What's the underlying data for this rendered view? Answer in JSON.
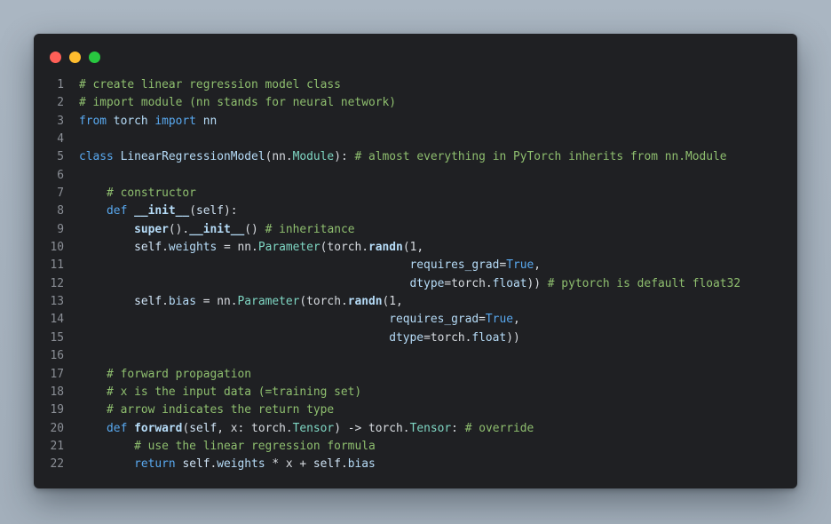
{
  "window": {
    "buttons": [
      "close",
      "minimize",
      "maximize"
    ]
  },
  "code": {
    "lines": [
      {
        "n": "1",
        "tokens": [
          {
            "t": "# create linear regression model class",
            "c": "comment"
          }
        ]
      },
      {
        "n": "2",
        "tokens": [
          {
            "t": "# import module (nn stands for neural network)",
            "c": "comment"
          }
        ]
      },
      {
        "n": "3",
        "tokens": [
          {
            "t": "from",
            "c": "kw"
          },
          {
            "t": " torch ",
            "c": "attr"
          },
          {
            "t": "import",
            "c": "kw"
          },
          {
            "t": " nn",
            "c": "attr"
          }
        ]
      },
      {
        "n": "4",
        "tokens": []
      },
      {
        "n": "5",
        "tokens": [
          {
            "t": "class",
            "c": "kw"
          },
          {
            "t": " LinearRegressionModel",
            "c": "cls"
          },
          {
            "t": "(nn.",
            "c": "plain"
          },
          {
            "t": "Module",
            "c": "type"
          },
          {
            "t": "): ",
            "c": "plain"
          },
          {
            "t": "# almost everything in PyTorch inherits from nn.Module",
            "c": "comment"
          }
        ]
      },
      {
        "n": "6",
        "tokens": []
      },
      {
        "n": "7",
        "tokens": [
          {
            "t": "    ",
            "c": "plain"
          },
          {
            "t": "# constructor",
            "c": "comment"
          }
        ]
      },
      {
        "n": "8",
        "tokens": [
          {
            "t": "    ",
            "c": "plain"
          },
          {
            "t": "def",
            "c": "kw"
          },
          {
            "t": " __init__",
            "c": "fn"
          },
          {
            "t": "(",
            "c": "plain"
          },
          {
            "t": "self",
            "c": "self"
          },
          {
            "t": "):",
            "c": "plain"
          }
        ]
      },
      {
        "n": "9",
        "tokens": [
          {
            "t": "        ",
            "c": "plain"
          },
          {
            "t": "super",
            "c": "fn"
          },
          {
            "t": "().",
            "c": "plain"
          },
          {
            "t": "__init__",
            "c": "fn"
          },
          {
            "t": "() ",
            "c": "plain"
          },
          {
            "t": "# inheritance",
            "c": "comment"
          }
        ]
      },
      {
        "n": "10",
        "tokens": [
          {
            "t": "        ",
            "c": "plain"
          },
          {
            "t": "self",
            "c": "self"
          },
          {
            "t": ".",
            "c": "plain"
          },
          {
            "t": "weights",
            "c": "attr"
          },
          {
            "t": " = nn.",
            "c": "plain"
          },
          {
            "t": "Parameter",
            "c": "type"
          },
          {
            "t": "(torch.",
            "c": "plain"
          },
          {
            "t": "randn",
            "c": "fn"
          },
          {
            "t": "(1,",
            "c": "plain"
          }
        ]
      },
      {
        "n": "11",
        "tokens": [
          {
            "t": "                                                ",
            "c": "plain"
          },
          {
            "t": "requires_grad",
            "c": "attr"
          },
          {
            "t": "=",
            "c": "plain"
          },
          {
            "t": "True",
            "c": "bool"
          },
          {
            "t": ",",
            "c": "plain"
          }
        ]
      },
      {
        "n": "12",
        "tokens": [
          {
            "t": "                                                ",
            "c": "plain"
          },
          {
            "t": "dtype",
            "c": "attr"
          },
          {
            "t": "=torch.",
            "c": "plain"
          },
          {
            "t": "float",
            "c": "attr"
          },
          {
            "t": ")) ",
            "c": "plain"
          },
          {
            "t": "# pytorch is default float32",
            "c": "comment"
          }
        ]
      },
      {
        "n": "13",
        "tokens": [
          {
            "t": "        ",
            "c": "plain"
          },
          {
            "t": "self",
            "c": "self"
          },
          {
            "t": ".",
            "c": "plain"
          },
          {
            "t": "bias",
            "c": "attr"
          },
          {
            "t": " = nn.",
            "c": "plain"
          },
          {
            "t": "Parameter",
            "c": "type"
          },
          {
            "t": "(torch.",
            "c": "plain"
          },
          {
            "t": "randn",
            "c": "fn"
          },
          {
            "t": "(1,",
            "c": "plain"
          }
        ]
      },
      {
        "n": "14",
        "tokens": [
          {
            "t": "                                             ",
            "c": "plain"
          },
          {
            "t": "requires_grad",
            "c": "attr"
          },
          {
            "t": "=",
            "c": "plain"
          },
          {
            "t": "True",
            "c": "bool"
          },
          {
            "t": ",",
            "c": "plain"
          }
        ]
      },
      {
        "n": "15",
        "tokens": [
          {
            "t": "                                             ",
            "c": "plain"
          },
          {
            "t": "dtype",
            "c": "attr"
          },
          {
            "t": "=torch.",
            "c": "plain"
          },
          {
            "t": "float",
            "c": "attr"
          },
          {
            "t": "))",
            "c": "plain"
          }
        ]
      },
      {
        "n": "16",
        "tokens": []
      },
      {
        "n": "17",
        "tokens": [
          {
            "t": "    ",
            "c": "plain"
          },
          {
            "t": "# forward propagation",
            "c": "comment"
          }
        ]
      },
      {
        "n": "18",
        "tokens": [
          {
            "t": "    ",
            "c": "plain"
          },
          {
            "t": "# x is the input data (=training set)",
            "c": "comment"
          }
        ]
      },
      {
        "n": "19",
        "tokens": [
          {
            "t": "    ",
            "c": "plain"
          },
          {
            "t": "# arrow indicates the return type",
            "c": "comment"
          }
        ]
      },
      {
        "n": "20",
        "tokens": [
          {
            "t": "    ",
            "c": "plain"
          },
          {
            "t": "def",
            "c": "kw"
          },
          {
            "t": " forward",
            "c": "fn"
          },
          {
            "t": "(",
            "c": "plain"
          },
          {
            "t": "self",
            "c": "self"
          },
          {
            "t": ", x: torch.",
            "c": "plain"
          },
          {
            "t": "Tensor",
            "c": "type"
          },
          {
            "t": ") -> torch.",
            "c": "plain"
          },
          {
            "t": "Tensor",
            "c": "type"
          },
          {
            "t": ": ",
            "c": "plain"
          },
          {
            "t": "# override",
            "c": "comment"
          }
        ]
      },
      {
        "n": "21",
        "tokens": [
          {
            "t": "        ",
            "c": "plain"
          },
          {
            "t": "# use the linear regression formula",
            "c": "comment"
          }
        ]
      },
      {
        "n": "22",
        "tokens": [
          {
            "t": "        ",
            "c": "plain"
          },
          {
            "t": "return",
            "c": "kw"
          },
          {
            "t": " ",
            "c": "plain"
          },
          {
            "t": "self",
            "c": "self"
          },
          {
            "t": ".",
            "c": "plain"
          },
          {
            "t": "weights",
            "c": "attr"
          },
          {
            "t": " * x + ",
            "c": "plain"
          },
          {
            "t": "self",
            "c": "self"
          },
          {
            "t": ".",
            "c": "plain"
          },
          {
            "t": "bias",
            "c": "attr"
          }
        ]
      }
    ]
  }
}
